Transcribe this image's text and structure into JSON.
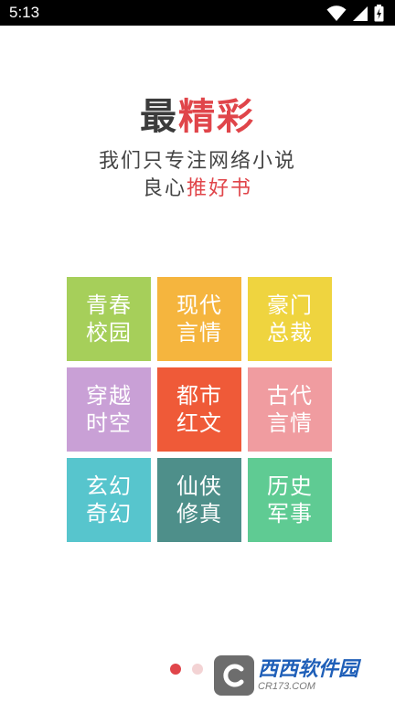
{
  "status_bar": {
    "time": "5:13",
    "icons": [
      "wifi-icon",
      "signal-icon",
      "battery-icon"
    ]
  },
  "hero": {
    "title_dark": "最",
    "title_red": "精彩",
    "subtitle_line1": "我们只专注网络小说",
    "subtitle_line2_plain": "良心",
    "subtitle_line2_red": "推好书"
  },
  "categories": [
    {
      "line1": "青春",
      "line2": "校园",
      "color": "#a6cf5a"
    },
    {
      "line1": "现代",
      "line2": "言情",
      "color": "#f5b53e"
    },
    {
      "line1": "豪门",
      "line2": "总裁",
      "color": "#efd43f"
    },
    {
      "line1": "穿越",
      "line2": "时空",
      "color": "#c9a0d6"
    },
    {
      "line1": "都市",
      "line2": "红文",
      "color": "#ef5a38"
    },
    {
      "line1": "古代",
      "line2": "言情",
      "color": "#f09ca0"
    },
    {
      "line1": "玄幻",
      "line2": "奇幻",
      "color": "#57c5cd"
    },
    {
      "line1": "仙侠",
      "line2": "修真",
      "color": "#4e8f8a"
    },
    {
      "line1": "历史",
      "line2": "军事",
      "color": "#5fcb93"
    }
  ],
  "pager": {
    "active_color": "#e0454a",
    "inactive_color": "#f3d3d4"
  },
  "watermark": {
    "main": "西西软件园",
    "sub": "CR173.COM"
  }
}
